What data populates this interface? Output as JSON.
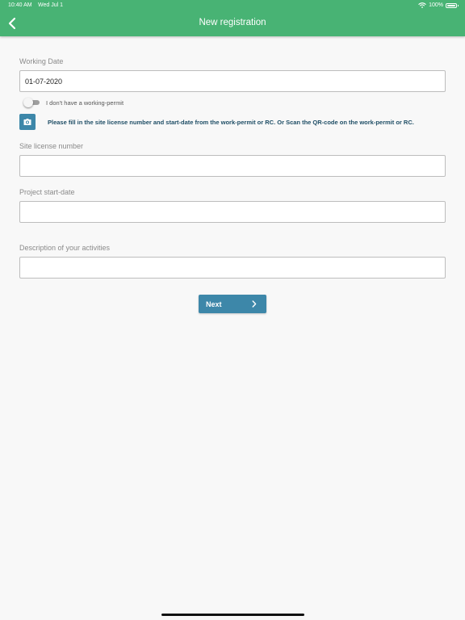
{
  "status_bar": {
    "time": "10:40 AM",
    "date": "Wed Jul 1",
    "battery": "100%",
    "icons": [
      "wifi-icon",
      "battery-icon"
    ]
  },
  "header": {
    "title": "New registration",
    "back_icon": "chevron-left-icon",
    "color": "#48b374"
  },
  "form": {
    "working_date": {
      "label": "Working Date",
      "value": "01-07-2020"
    },
    "no_permit_toggle": {
      "label": "I don't have a working-permit",
      "enabled": false
    },
    "scan": {
      "icon": "camera-icon",
      "instruction": "Please fill in the site license number and start-date from the work-permit or RC. Or Scan the QR-code on the work-permit or RC."
    },
    "site_license": {
      "label": "Site license number",
      "value": ""
    },
    "project_start": {
      "label": "Project start-date",
      "value": ""
    },
    "activities": {
      "label": "Description of your activities",
      "value": ""
    },
    "next_button": {
      "label": "Next",
      "icon": "chevron-right-icon",
      "color": "#3d87a9"
    }
  }
}
